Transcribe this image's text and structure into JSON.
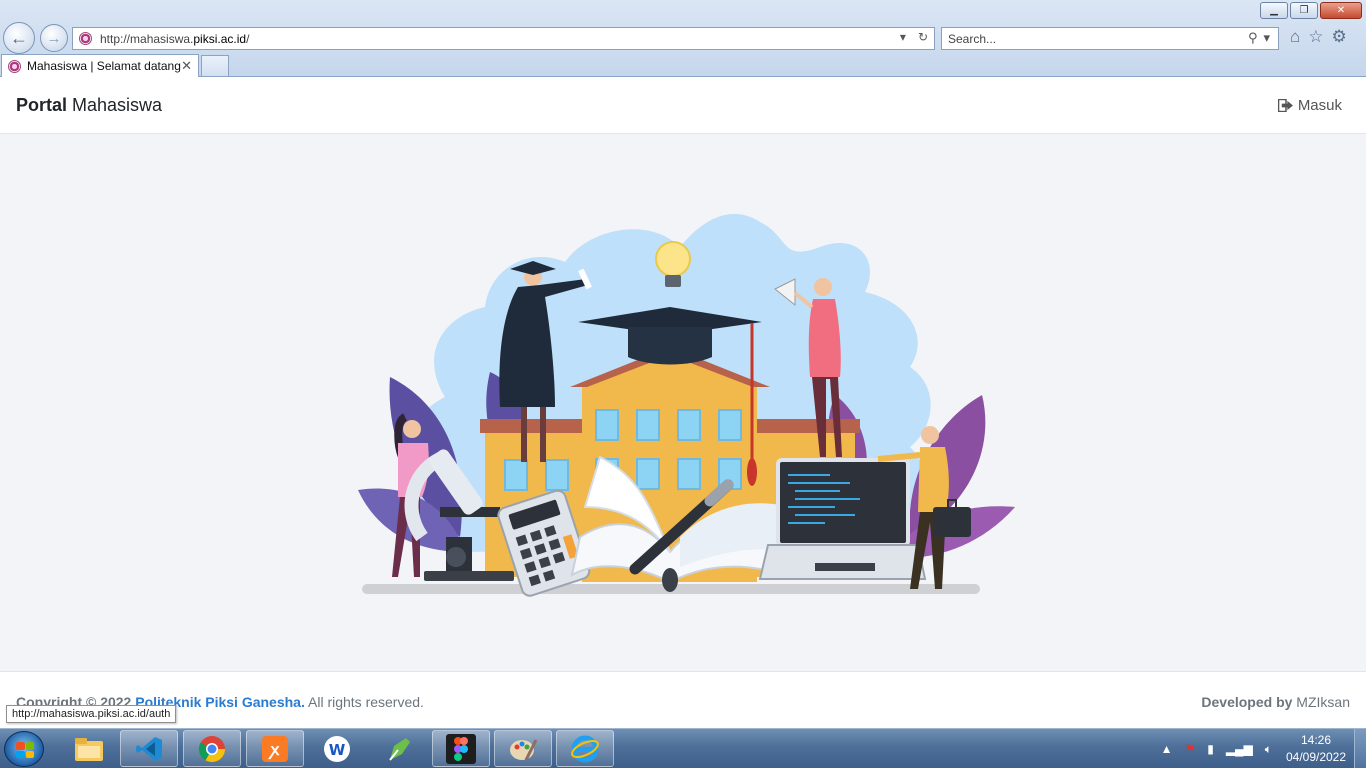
{
  "browser": {
    "url_prefix": "http://mahasiswa.",
    "url_domain": "piksi.ac.id",
    "url_suffix": "/",
    "search_placeholder": "Search...",
    "tab_title": "Mahasiswa | Selamat datang",
    "tab_close": "✕"
  },
  "header": {
    "brand_bold": "Portal",
    "brand_rest": " Mahasiswa",
    "login_label": "Masuk"
  },
  "footer": {
    "copyright_prefix": "Copyright © 2022 ",
    "institution": "Politeknik Piksi Ganesha.",
    "rights": " All rights reserved.",
    "developed_by_label": "Developed by",
    "developer": " MZIksan"
  },
  "status_tooltip": "http://mahasiswa.piksi.ac.id/auth",
  "taskbar": {
    "apps": [
      "windows-explorer",
      "vscode",
      "chrome",
      "xampp",
      "app-w",
      "inkscape",
      "figma",
      "paint",
      "internet-explorer"
    ],
    "time": "14:26",
    "date": "04/09/2022"
  },
  "colors": {
    "link_blue": "#2b7bd1",
    "page_bg": "#f3f4f7",
    "building_yellow": "#f1b84b",
    "cloud_blue": "#bfe0fa"
  }
}
